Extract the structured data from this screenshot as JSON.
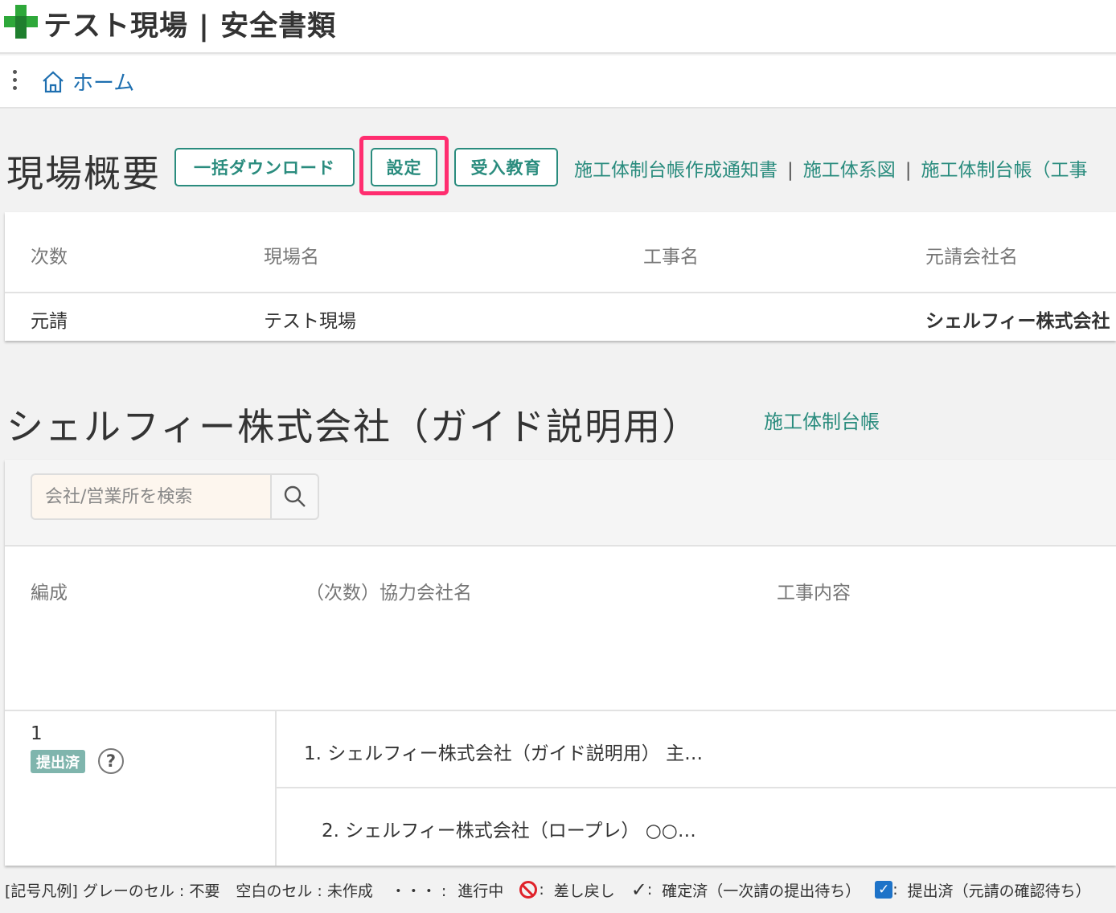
{
  "header": {
    "title": "テスト現場 | 安全書類"
  },
  "breadcrumb": {
    "home_label": "ホーム"
  },
  "overview": {
    "title": "現場概要",
    "buttons": {
      "bulk_download": "一括ダウンロード",
      "settings": "設定",
      "reception_education": "受入教育"
    },
    "links": [
      "施工体制台帳作成通知書",
      "施工体系図",
      "施工体制台帳（工事"
    ],
    "link_separator": "|",
    "table": {
      "headers": [
        "次数",
        "現場名",
        "工事名",
        "元請会社名"
      ],
      "row": [
        "元請",
        "テスト現場",
        "",
        "シェルフィー株式会社"
      ]
    }
  },
  "company": {
    "title": "シェルフィー株式会社（ガイド説明用）",
    "ledger_link": "施工体制台帳",
    "search": {
      "placeholder": "会社/営業所を検索",
      "value": ""
    },
    "table": {
      "headers": [
        "編成",
        "（次数）協力会社名",
        "工事内容"
      ],
      "group_number": "1",
      "status_badge": "提出済",
      "help_glyph": "?",
      "rows": [
        "1. シェルフィー株式会社（ガイド説明用） 主…",
        "2. シェルフィー株式会社（ロープレ） ○○…"
      ]
    }
  },
  "legend": {
    "prefix": "[記号凡例] グレーのセル : 不要",
    "blank": "空白のセル : 未作成",
    "in_progress_symbol": "・・・ :",
    "in_progress": "進行中",
    "returned_suffix": ":",
    "returned": "差し戻し",
    "confirmed_symbol": "✓",
    "confirmed_suffix": ":",
    "confirmed": "確定済（一次請の提出待ち）",
    "submitted_symbol": "✓",
    "submitted_suffix": ":",
    "submitted": "提出済（元請の確認待ち）"
  },
  "colors": {
    "accent": "#2a8c7e",
    "highlight": "#ff2d6f",
    "link_blue": "#1e6fb0",
    "logo_green": "#2ea83a"
  }
}
